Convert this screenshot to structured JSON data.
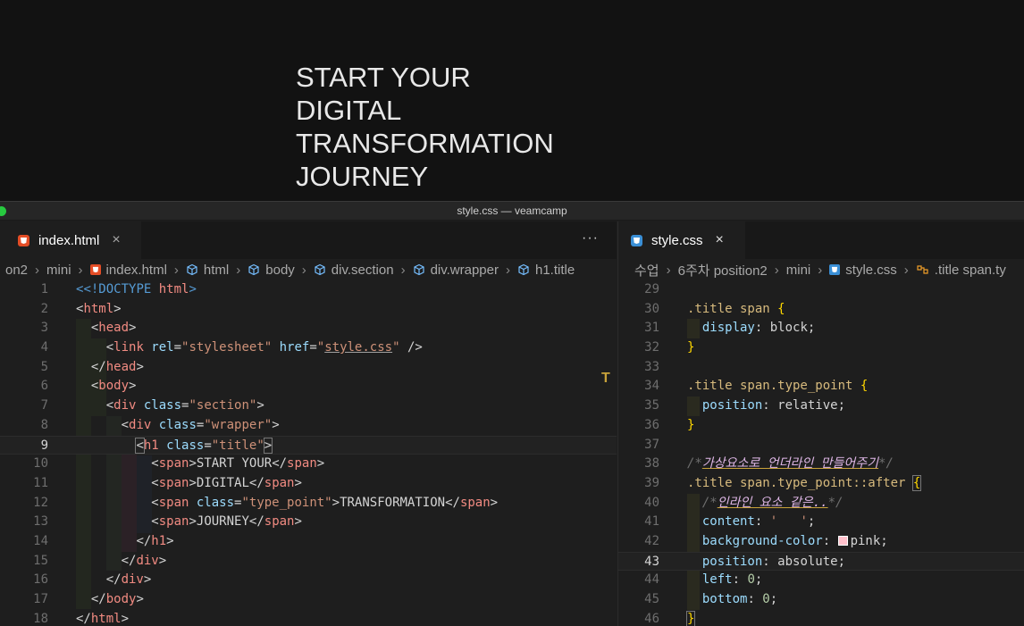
{
  "preview": {
    "title_lines": [
      "START YOUR",
      "DIGITAL",
      "TRANSFORMATION",
      "JOURNEY"
    ]
  },
  "window": {
    "title": "style.css — veamcamp"
  },
  "left_pane": {
    "tab": {
      "label": "index.html",
      "close": "×"
    },
    "more": "···",
    "breadcrumb": [
      "on2",
      "mini",
      "index.html",
      "html",
      "body",
      "div.section",
      "div.wrapper",
      "h1.title"
    ],
    "lines": [
      {
        "n": "1"
      },
      {
        "n": "2"
      },
      {
        "n": "3"
      },
      {
        "n": "4"
      },
      {
        "n": "5"
      },
      {
        "n": "6"
      },
      {
        "n": "7"
      },
      {
        "n": "8"
      },
      {
        "n": "9"
      },
      {
        "n": "10"
      },
      {
        "n": "11"
      },
      {
        "n": "12"
      },
      {
        "n": "13"
      },
      {
        "n": "14"
      },
      {
        "n": "15"
      },
      {
        "n": "16"
      },
      {
        "n": "17"
      },
      {
        "n": "18"
      }
    ],
    "code": {
      "l1_doctype": "<!DOCTYPE",
      "l1_html": " html",
      "l1_close": ">",
      "l4_link": "link",
      "l4_rel": " rel",
      "l4_rel_val": "\"stylesheet\"",
      "l4_href": " href",
      "l4_href_q1": "\"",
      "l4_href_val": "style.css",
      "l4_href_q2": "\"",
      "l4_end": " />",
      "class_attr": " class",
      "section_val": "\"section\"",
      "wrapper_val": "\"wrapper\"",
      "title_val": "\"title\"",
      "type_point_val": "\"type_point\"",
      "text_start": "START YOUR",
      "text_digital": "DIGITAL",
      "text_transformation": "TRANSFORMATION",
      "text_journey": "JOURNEY"
    }
  },
  "right_pane": {
    "tab": {
      "label": "style.css",
      "close": "×"
    },
    "breadcrumb": [
      "수업",
      "6주차 position2",
      "mini",
      "style.css",
      ".title span.ty"
    ],
    "lines": [
      {
        "n": "29"
      },
      {
        "n": "30"
      },
      {
        "n": "31"
      },
      {
        "n": "32"
      },
      {
        "n": "33"
      },
      {
        "n": "34"
      },
      {
        "n": "35"
      },
      {
        "n": "36"
      },
      {
        "n": "37"
      },
      {
        "n": "38"
      },
      {
        "n": "39"
      },
      {
        "n": "40"
      },
      {
        "n": "41"
      },
      {
        "n": "42"
      },
      {
        "n": "43"
      },
      {
        "n": "44"
      },
      {
        "n": "45"
      },
      {
        "n": "46"
      }
    ],
    "code": {
      "sel1": ".title span",
      "display_prop": "display",
      "display_val": "block",
      "sel2": ".title span.type_point",
      "position_prop": "position",
      "relative_val": "relative",
      "comment1_open": "/*",
      "comment1_text": "가상요소로 언더라인 만들어주기",
      "comment1_close": "*/",
      "sel3": ".title span.type_point::after",
      "comment2_open": "/*",
      "comment2_text": "인라인 요소 같은..",
      "comment2_close": "*/",
      "content_prop": "content",
      "content_val": "'   '",
      "bg_prop": "background-color",
      "bg_val": "pink",
      "absolute_val": "absolute",
      "left_prop": "left",
      "bottom_prop": "bottom",
      "zero": "0"
    }
  },
  "colors": {
    "pink_swatch": "#ffc0cb",
    "html_icon": "#e44d26",
    "css_icon": "#3a8fd6"
  }
}
